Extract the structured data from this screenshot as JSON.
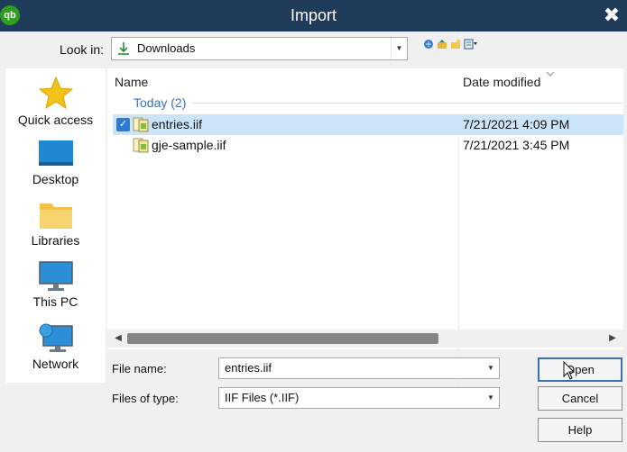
{
  "window": {
    "title": "Import",
    "app_logo": "qb",
    "close_glyph": "✖"
  },
  "look_in": {
    "label": "Look in:",
    "value": "Downloads",
    "icon": "download-arrow-icon"
  },
  "toolbar": {
    "icons": [
      "back-globe-icon",
      "up-folder-icon",
      "new-folder-icon",
      "view-menu-icon"
    ]
  },
  "places": [
    {
      "label": "Quick access",
      "icon": "star-icon"
    },
    {
      "label": "Desktop",
      "icon": "desktop-icon"
    },
    {
      "label": "Libraries",
      "icon": "folder-icon"
    },
    {
      "label": "This PC",
      "icon": "monitor-icon"
    },
    {
      "label": "Network",
      "icon": "network-icon"
    }
  ],
  "columns": {
    "name": "Name",
    "date": "Date modified"
  },
  "group": {
    "label": "Today (2)"
  },
  "files": [
    {
      "name": "entries.iif",
      "date": "7/21/2021 4:09 PM",
      "selected": true
    },
    {
      "name": "gje-sample.iif",
      "date": "7/21/2021 3:45 PM",
      "selected": false
    }
  ],
  "file_name": {
    "label": "File name:",
    "value": "entries.iif"
  },
  "file_type": {
    "label": "Files of type:",
    "value": "IIF Files (*.IIF)"
  },
  "buttons": {
    "open": "Open",
    "cancel": "Cancel",
    "help": "Help"
  },
  "colors": {
    "titlebar": "#1f3b5a",
    "selection": "#cce4f7",
    "group_text": "#3b6fb5",
    "check": "#2a7bd5",
    "logo": "#2ca01c"
  }
}
